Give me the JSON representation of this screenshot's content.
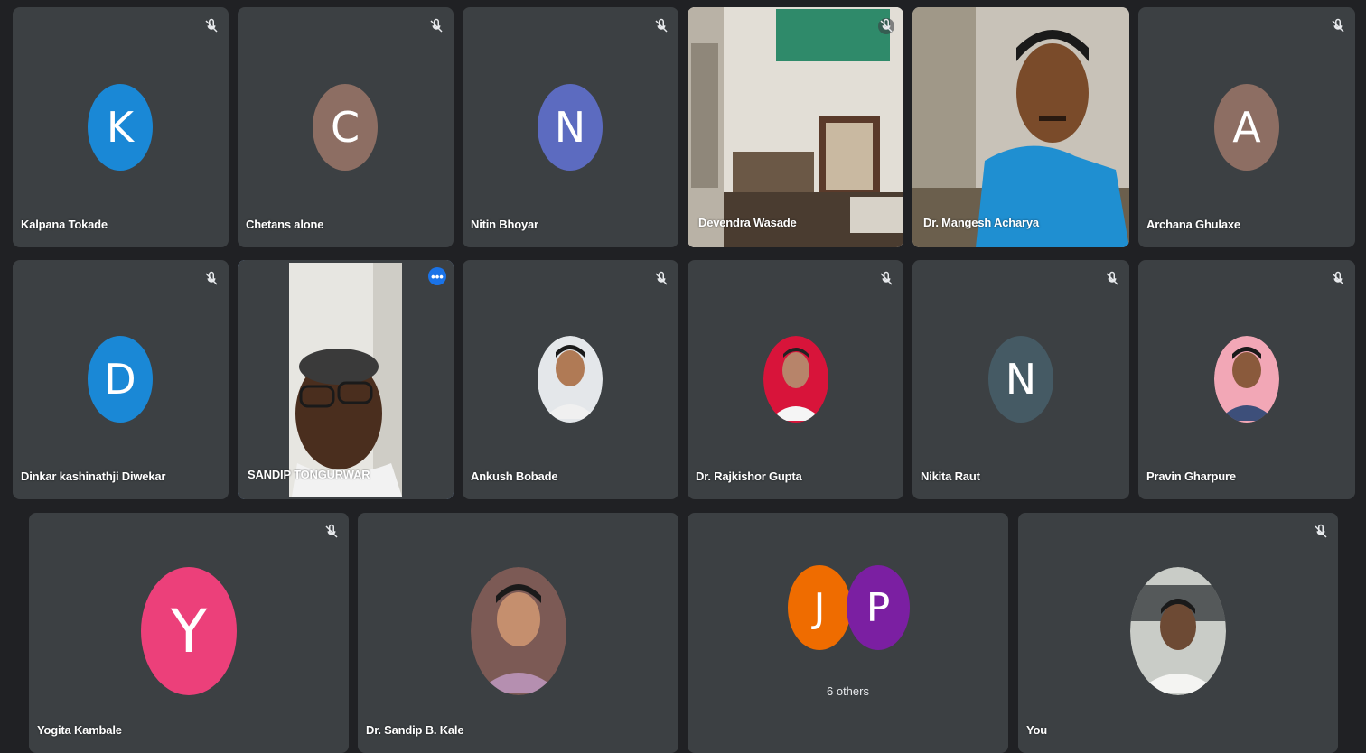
{
  "colors": {
    "background": "#202124",
    "tile": "#3c4043",
    "active_outline": "#8ab4f8"
  },
  "icons": {
    "muted": "mic-off-icon",
    "more": "more-options-icon"
  },
  "participants": [
    {
      "name": "Kalpana Tokade",
      "initial": "K",
      "avatar_color": "#1a88d6",
      "muted": true
    },
    {
      "name": "Chetans alone",
      "initial": "C",
      "avatar_color": "#8d6e63",
      "muted": true
    },
    {
      "name": "Nitin Bhoyar",
      "initial": "N",
      "avatar_color": "#5c6bc0",
      "muted": true
    },
    {
      "name": "Devendra Wasade",
      "type": "video",
      "muted": true
    },
    {
      "name": "Dr. Mangesh Acharya",
      "type": "video",
      "muted": false
    },
    {
      "name": "Archana Ghulaxe",
      "initial": "A",
      "avatar_color": "#8d6e63",
      "muted": true
    },
    {
      "name": "Dinkar kashinathji Diwekar",
      "initial": "D",
      "avatar_color": "#1a88d6",
      "muted": true
    },
    {
      "name": "SANDIP TONGURWAR",
      "type": "video",
      "muted": false,
      "active_speaker": true,
      "more_label": "•••"
    },
    {
      "name": "Ankush Bobade",
      "type": "photo",
      "muted": true
    },
    {
      "name": "Dr. Rajkishor Gupta",
      "type": "photo",
      "muted": true
    },
    {
      "name": "Nikita Raut",
      "initial": "N",
      "avatar_color": "#455a64",
      "muted": true
    },
    {
      "name": "Pravin Gharpure",
      "type": "photo",
      "muted": true
    },
    {
      "name": "Yogita Kambale",
      "initial": "Y",
      "avatar_color": "#ec407a",
      "muted": true
    },
    {
      "name": "Dr. Sandip B. Kale",
      "type": "photo",
      "muted": false
    },
    {
      "name": "",
      "type": "group",
      "group": [
        {
          "initial": "J",
          "avatar_color": "#ef6c00"
        },
        {
          "initial": "P",
          "avatar_color": "#7b1fa2"
        }
      ],
      "others_label": "6 others",
      "muted": false
    },
    {
      "name": "You",
      "type": "photo",
      "muted": true
    }
  ]
}
